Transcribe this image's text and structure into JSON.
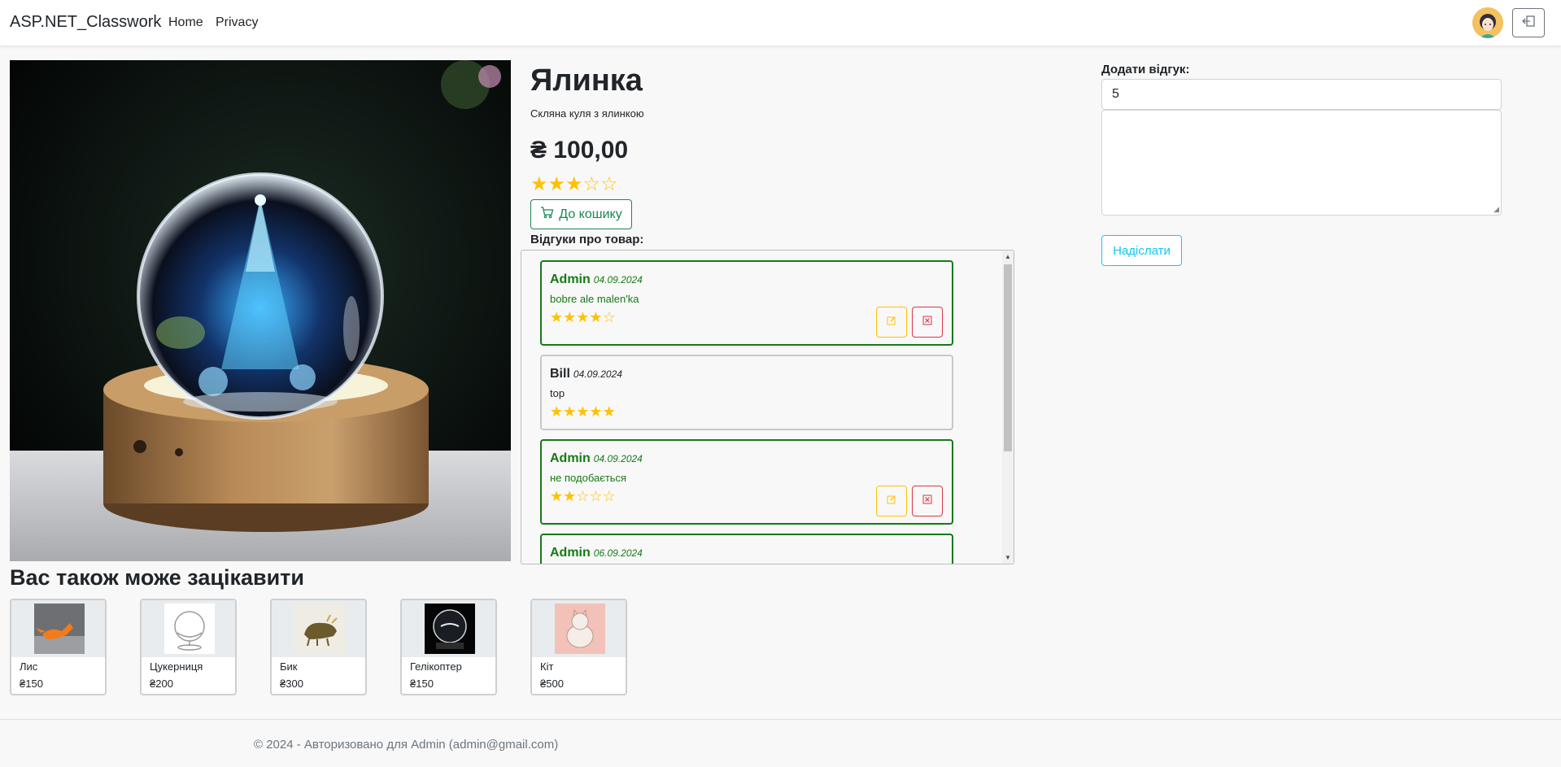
{
  "navbar": {
    "brand": "ASP.NET_Classwork",
    "links": [
      "Home",
      "Privacy"
    ],
    "avatar_icon": "user-avatar-icon",
    "logout_icon": "logout-icon"
  },
  "product": {
    "title": "Ялинка",
    "description": "Скляна куля з ялинкою",
    "price": "₴ 100,00",
    "rating": 3,
    "rating_max": 5,
    "cart_button": "До кошику",
    "cart_icon": "cart-icon",
    "image_icon": "crystal-ball-photo"
  },
  "reviews": {
    "heading": "Відгуки про товар:",
    "items": [
      {
        "author": "Admin",
        "date": "04.09.2024",
        "text": "bobre ale malen'ka",
        "rating": 4,
        "own": true
      },
      {
        "author": "Bill",
        "date": "04.09.2024",
        "text": "top",
        "rating": 5,
        "own": false
      },
      {
        "author": "Admin",
        "date": "04.09.2024",
        "text": "не подобається",
        "rating": 2,
        "own": true
      },
      {
        "author": "Admin",
        "date": "06.09.2024",
        "text": "",
        "rating": 0,
        "own": true
      }
    ]
  },
  "review_form": {
    "label": "Додати відгук:",
    "rating_value": "5",
    "comment_value": "",
    "submit_label": "Надіслати"
  },
  "recommendations": {
    "heading": "Вас також може зацікавити",
    "items": [
      {
        "name": "Лис",
        "price": "₴150"
      },
      {
        "name": "Цукерниця",
        "price": "₴200"
      },
      {
        "name": "Бик",
        "price": "₴300"
      },
      {
        "name": "Гелікоптер",
        "price": "₴150"
      },
      {
        "name": "Кіт",
        "price": "₴500"
      }
    ]
  },
  "footer": {
    "text": "© 2024 - Авторизовано для Admin (admin@gmail.com)"
  },
  "colors": {
    "own_review": "#157a15",
    "star": "#ffc107",
    "cart_button": "#198754",
    "submit_button": "#0dcaf0",
    "edit_button": "#ffc107",
    "delete_button": "#dc3545"
  }
}
